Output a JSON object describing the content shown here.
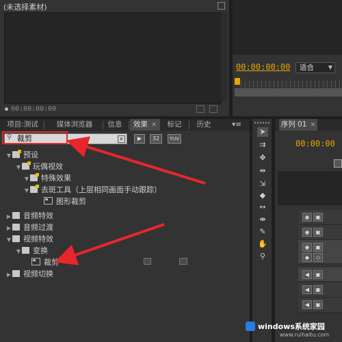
{
  "source_monitor": {
    "title": "(未选择素材)",
    "timecode": "00:00:00:00"
  },
  "program_monitor": {
    "timecode": "00:00:00:00",
    "fit_select": "适合"
  },
  "project_panel": {
    "tabs": [
      "项目:测试",
      "媒体浏览器",
      "信息",
      "效果",
      "标记",
      "历史"
    ],
    "active_tab": "效果",
    "search_value": "裁剪",
    "preset_button_labels": [
      "32",
      "YUV"
    ]
  },
  "effects_tree": [
    {
      "label": "预设",
      "depth": 0,
      "expanded": true,
      "icon": "folder-star"
    },
    {
      "label": "玩偶视效",
      "depth": 1,
      "expanded": true,
      "icon": "folder-star"
    },
    {
      "label": "特殊效果",
      "depth": 2,
      "expanded": true,
      "icon": "folder-star"
    },
    {
      "label": "去斑工具（上层相同画面手动跟踪）",
      "depth": 3,
      "expanded": true,
      "icon": "folder-star"
    },
    {
      "label": "图形裁剪",
      "depth": 4,
      "icon": "effect"
    },
    {
      "label": "音频特效",
      "depth": 0,
      "expanded": false,
      "icon": "folder"
    },
    {
      "label": "音频过渡",
      "depth": 0,
      "expanded": false,
      "icon": "folder"
    },
    {
      "label": "视频特效",
      "depth": 0,
      "expanded": true,
      "icon": "folder"
    },
    {
      "label": "变换",
      "depth": 1,
      "expanded": true,
      "icon": "folder"
    },
    {
      "label": "裁剪",
      "depth": 2,
      "icon": "effect"
    },
    {
      "label": "视频切换",
      "depth": 0,
      "expanded": false,
      "icon": "folder"
    }
  ],
  "sequence_panel": {
    "tab": "序列 01",
    "timecode": "00:00:00"
  },
  "watermark": {
    "text": "windows系统家园",
    "url": "www.ruihaitu.com"
  },
  "colors": {
    "timecode": "#e8a400",
    "annotation_red": "#e8262b",
    "panel_bg": "#333333"
  }
}
